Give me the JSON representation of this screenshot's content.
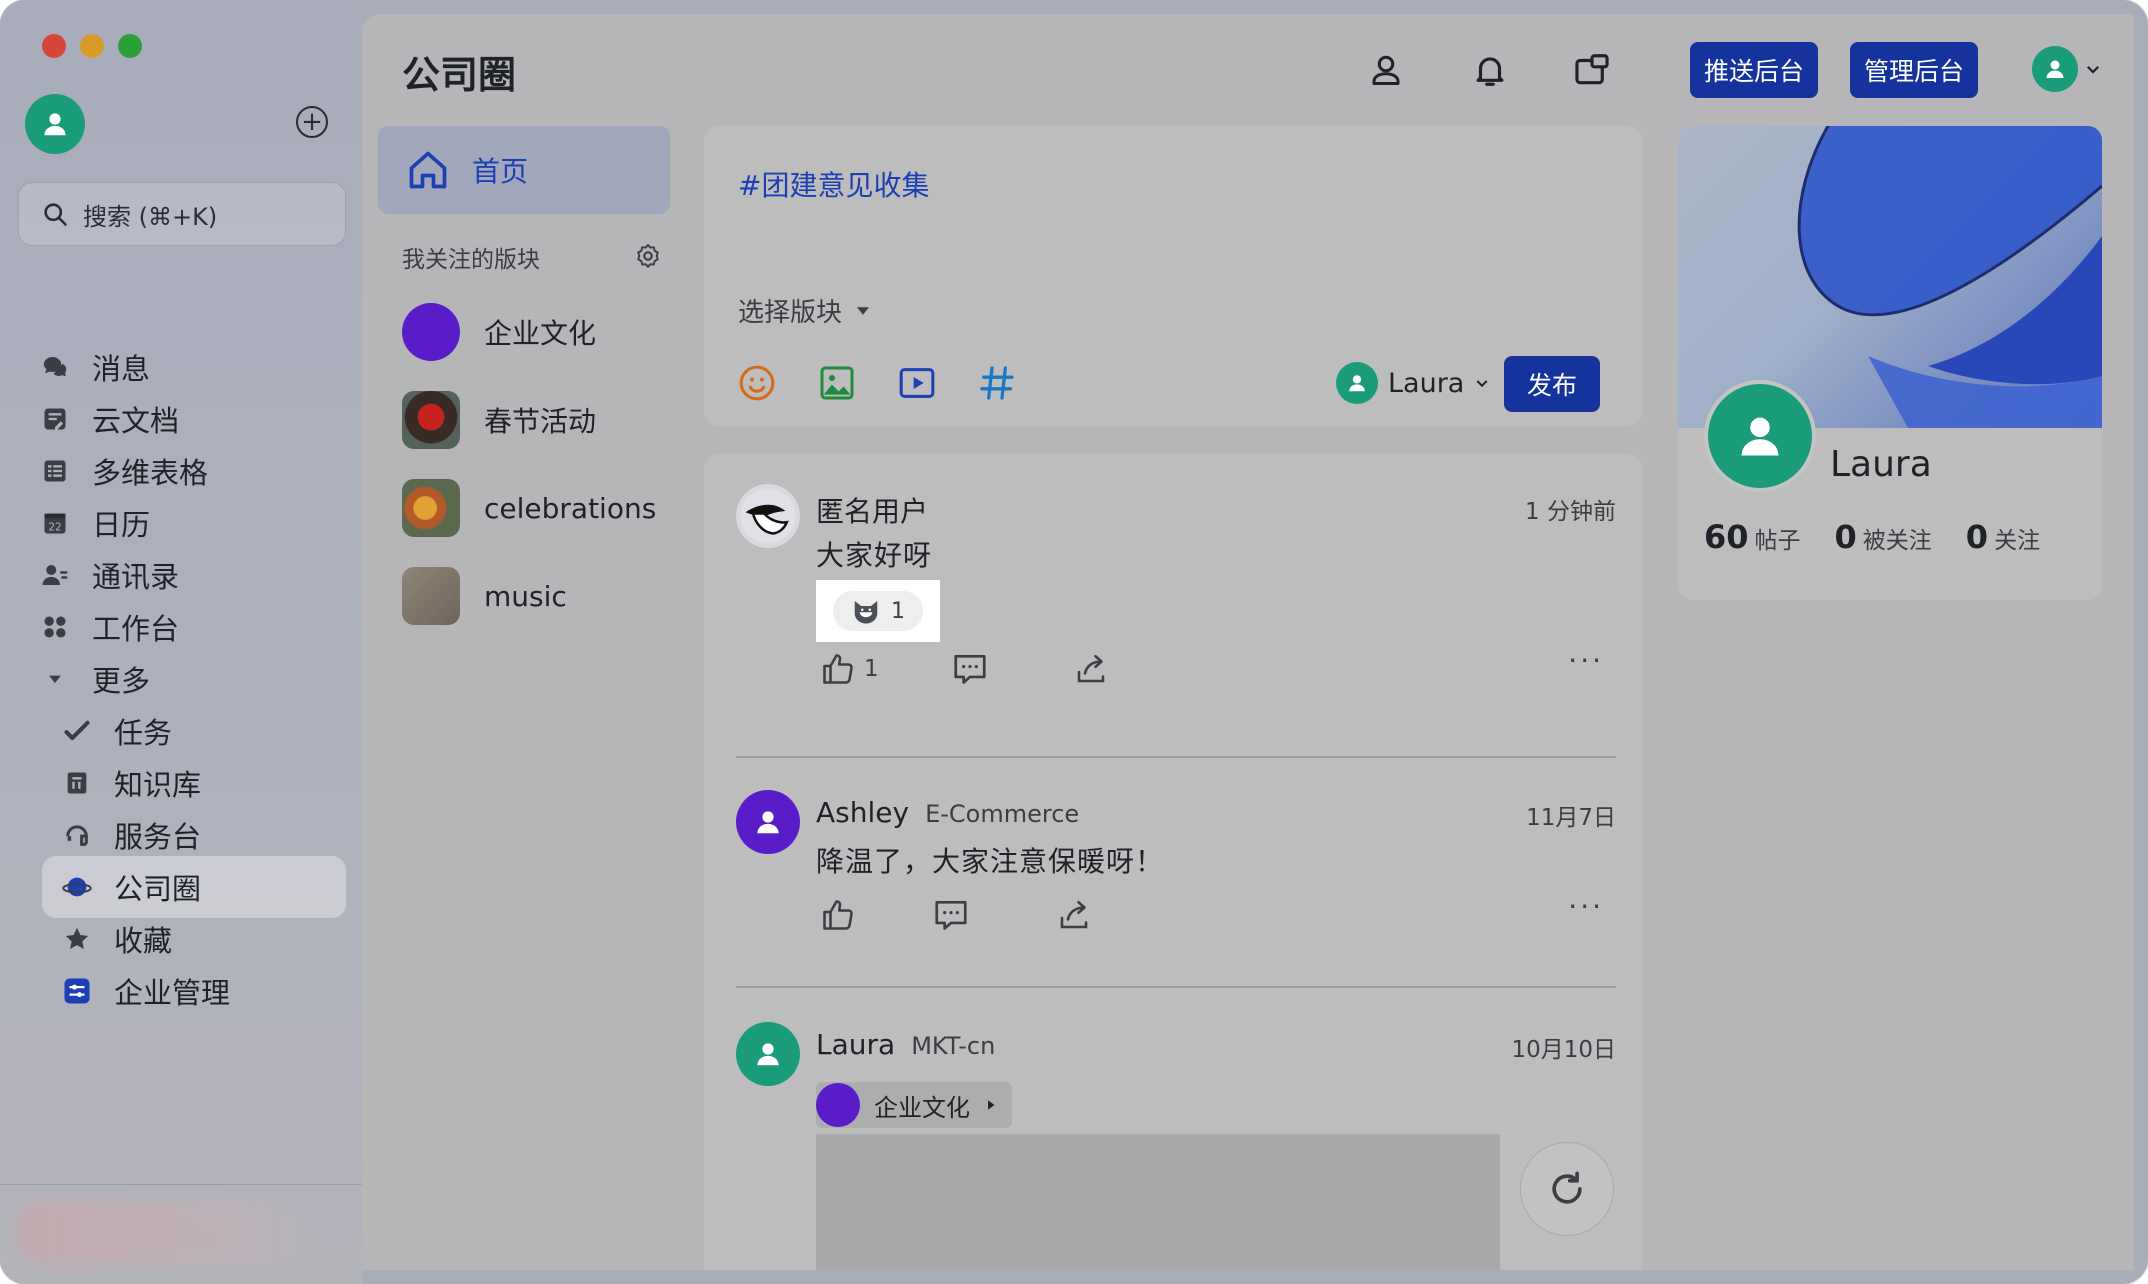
{
  "left_nav": {
    "search_placeholder": "搜索 (⌘+K)",
    "items": [
      {
        "label": "消息",
        "icon": "chat-icon"
      },
      {
        "label": "云文档",
        "icon": "document-icon"
      },
      {
        "label": "多维表格",
        "icon": "table-icon"
      },
      {
        "label": "日历",
        "icon": "calendar-icon",
        "calendar_day": "22"
      },
      {
        "label": "通讯录",
        "icon": "contacts-icon"
      },
      {
        "label": "工作台",
        "icon": "workspace-icon"
      },
      {
        "label": "更多",
        "icon": "caret-down-icon"
      }
    ],
    "sub_items": [
      {
        "label": "任务",
        "icon": "task-icon"
      },
      {
        "label": "知识库",
        "icon": "knowledge-icon"
      },
      {
        "label": "服务台",
        "icon": "headset-icon"
      },
      {
        "label": "公司圈",
        "icon": "planet-icon",
        "active": true
      },
      {
        "label": "收藏",
        "icon": "star-icon"
      },
      {
        "label": "企业管理",
        "icon": "admin-icon"
      }
    ]
  },
  "header": {
    "title": "公司圈",
    "push_admin_label": "推送后台",
    "manage_admin_label": "管理后台"
  },
  "forums": {
    "home_label": "首页",
    "followed_label": "我关注的版块",
    "items": [
      {
        "label": "企业文化",
        "thumb": "purple"
      },
      {
        "label": "春节活动",
        "thumb": "photo-red"
      },
      {
        "label": "celebrations",
        "thumb": "photo-food"
      },
      {
        "label": "music",
        "thumb": "photo-cat"
      }
    ]
  },
  "composer": {
    "topic_tag": "#团建意见收集",
    "select_forum_label": "选择版块",
    "user_name": "Laura",
    "publish_label": "发布"
  },
  "posts": [
    {
      "author": "匿名用户",
      "dept": "",
      "time": "1 分钟前",
      "text": "大家好呀",
      "reaction_count": "1",
      "like_count": "1"
    },
    {
      "author": "Ashley",
      "dept": "E-Commerce",
      "time": "11月7日",
      "text": "降温了，大家注意保暖呀！"
    },
    {
      "author": "Laura",
      "dept": "MKT-cn",
      "time": "10月10日",
      "forum_chip": "企业文化"
    }
  ],
  "profile": {
    "name": "Laura",
    "posts_count": "60",
    "posts_label": "帖子",
    "followers_count": "0",
    "followers_label": "被关注",
    "following_count": "0",
    "following_label": "关注"
  },
  "colors": {
    "accent": "#15339c",
    "link": "#1d3fb4",
    "avatar_green": "#1a9b79",
    "avatar_purple": "#5a1cc9"
  }
}
